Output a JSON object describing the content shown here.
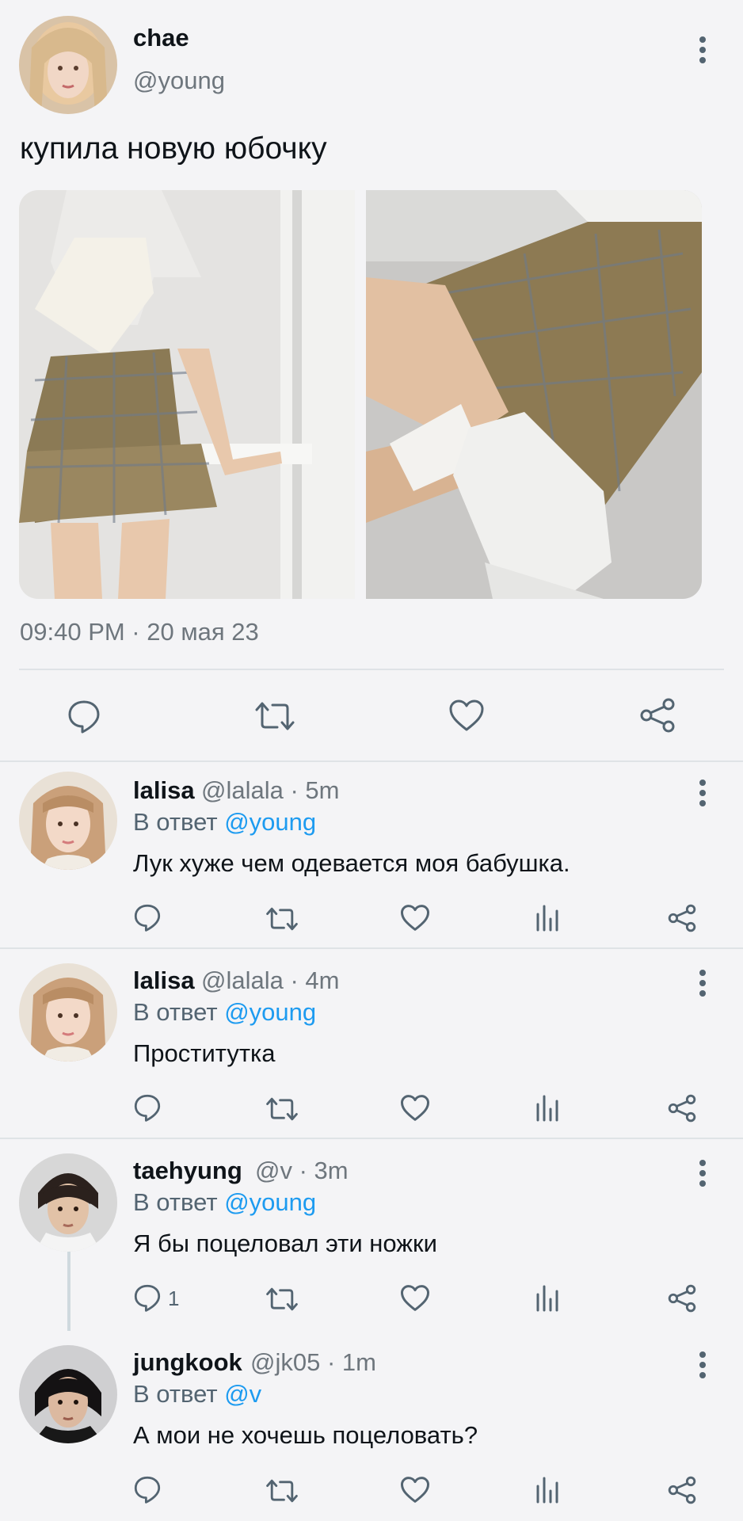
{
  "post": {
    "display_name": "chae",
    "handle": "@young",
    "text": "купила новую юбочку",
    "timestamp": "09:40 PM · 20 мая 23",
    "actions": [
      "reply-icon",
      "retweet-icon",
      "like-icon",
      "share-icon"
    ]
  },
  "replies": [
    {
      "display_name": "lalisa",
      "handle": "@lalala · 5m",
      "reply_label": "В ответ",
      "reply_mention": "@young",
      "text": "Лук хуже чем одевается моя бабушка.",
      "reply_count": ""
    },
    {
      "display_name": "lalisa",
      "handle": "@lalala · 4m",
      "reply_label": "В ответ",
      "reply_mention": "@young",
      "text": "Проститутка",
      "reply_count": ""
    },
    {
      "display_name": "taehyung",
      "handle": "@v · 3m",
      "reply_label": "В ответ",
      "reply_mention": "@young",
      "text": "Я бы поцеловал эти ножки",
      "reply_count": "1"
    },
    {
      "display_name": "jungkook",
      "handle": "@jk05 · 1m",
      "reply_label": "В ответ",
      "reply_mention": "@v",
      "text": "А мои не хочешь поцеловать?",
      "reply_count": ""
    }
  ],
  "colors": {
    "link": "#1d9bf0",
    "secondary_text": "#6e767d",
    "background": "#f4f4f6"
  }
}
